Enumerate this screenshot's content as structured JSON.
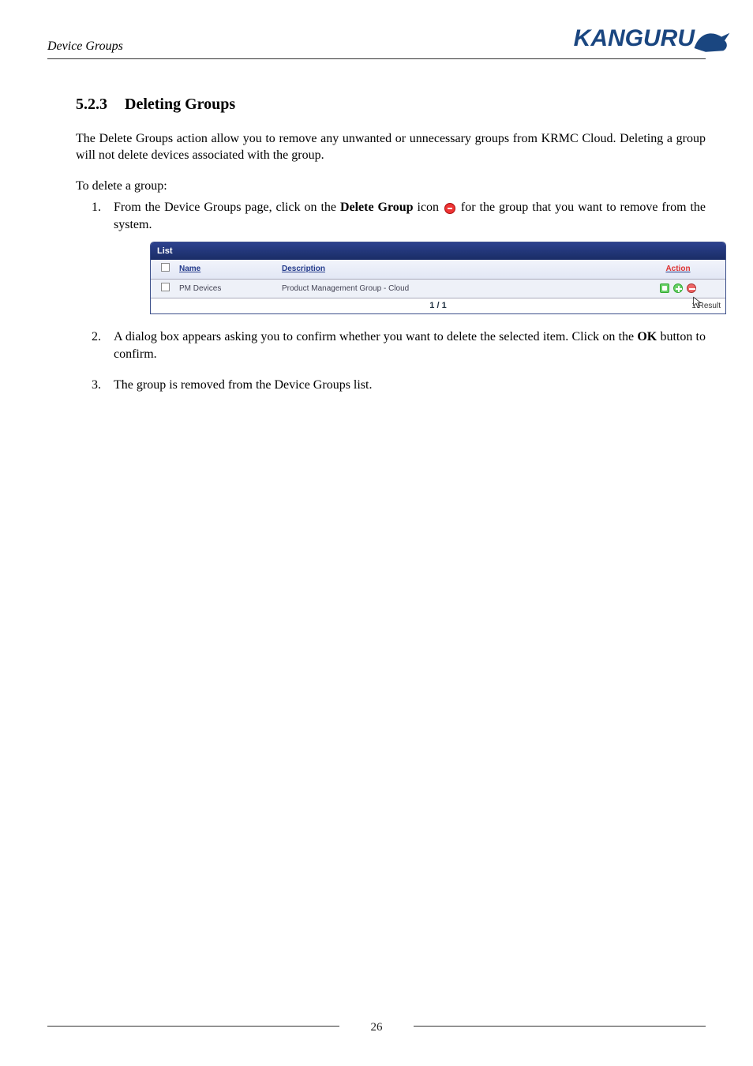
{
  "header": {
    "title": "Device Groups",
    "logo_text": "KANGURU"
  },
  "section": {
    "number": "5.2.3",
    "title": "Deleting Groups"
  },
  "intro": "The Delete Groups action allow you to remove any unwanted or unnecessary groups from KRMC Cloud. Deleting a group will not delete devices associated with the group.",
  "lead": "To delete a group:",
  "steps": {
    "s1_a": "From the Device Groups page, click on the ",
    "s1_b": "Delete Group",
    "s1_c": " icon ",
    "s1_d": " for the group that you want to remove from the system.",
    "s2_a": "A dialog box appears asking you to confirm whether you want to delete the selected item. Click on the ",
    "s2_b": "OK",
    "s2_c": " button to confirm.",
    "s3": "The group is removed from the Device Groups list."
  },
  "list": {
    "title": "List",
    "cols": {
      "name": "Name",
      "desc": "Description",
      "action": "Action"
    },
    "row": {
      "name": "PM Devices",
      "desc": "Product Management Group - Cloud"
    },
    "pager": "1 / 1",
    "result": "1 Result"
  },
  "page_number": "26",
  "chart_data": {
    "type": "table",
    "title": "List",
    "columns": [
      "Name",
      "Description",
      "Action"
    ],
    "rows": [
      [
        "PM Devices",
        "Product Management Group - Cloud",
        "edit / add / delete"
      ]
    ],
    "pager": "1 / 1",
    "result_count": "1 Result"
  }
}
